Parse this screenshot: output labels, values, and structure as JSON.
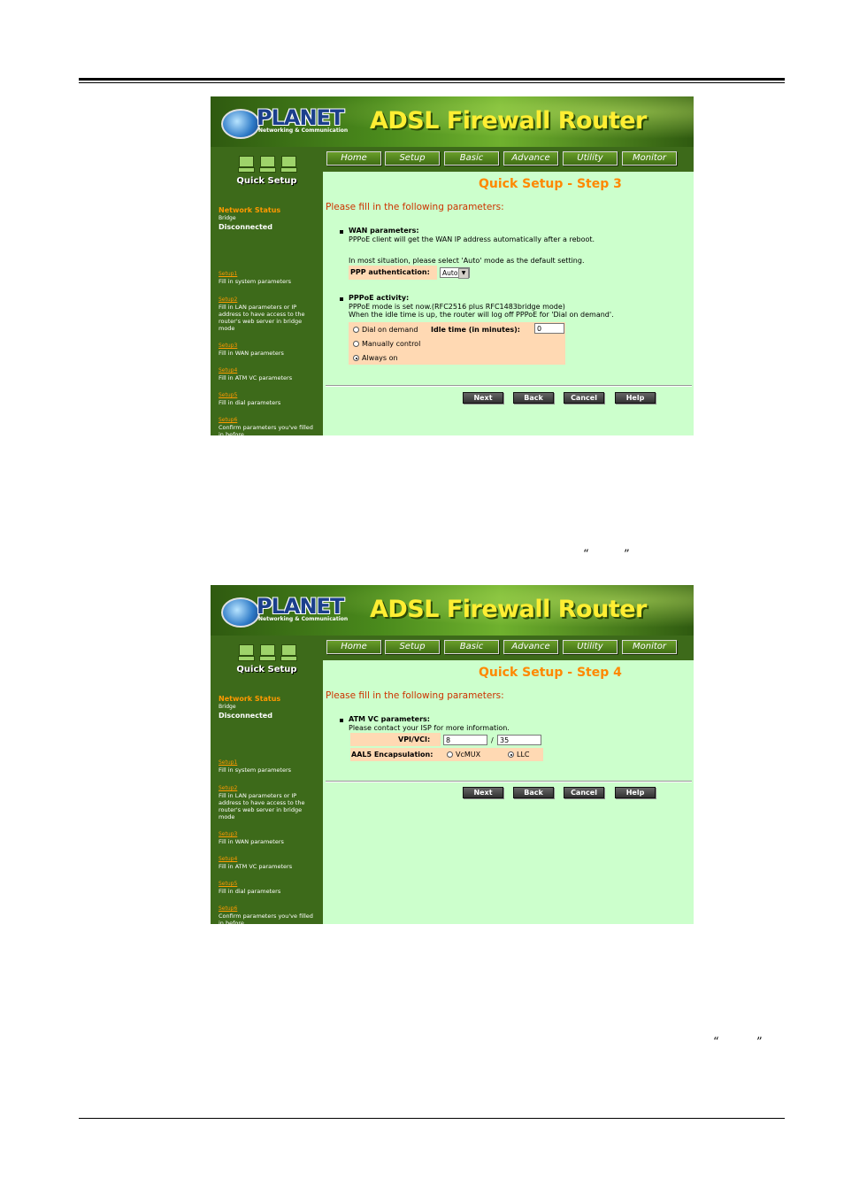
{
  "doc": {
    "quote_marks_1": [
      "“",
      "”"
    ],
    "quote_marks_2": [
      "“",
      "”"
    ]
  },
  "router": {
    "logo_text": "PLANET",
    "logo_tagline": "Networking & Communication",
    "product_name": "ADSL  Firewall Router",
    "nav": [
      "Home",
      "Setup",
      "Basic",
      "Advance",
      "Utility",
      "Monitor"
    ],
    "sidebar": {
      "quick_setup": "Quick Setup",
      "network_status_label": "Network Status",
      "mode": "Bridge",
      "status": "Disconnected",
      "steps": [
        {
          "link": "Setup1",
          "desc": "Fill in system parameters"
        },
        {
          "link": "Setup2",
          "desc": "Fill in LAN parameters or IP address to have access to the router's web server in bridge mode"
        },
        {
          "link": "Setup3",
          "desc": "Fill in WAN parameters"
        },
        {
          "link": "Setup4",
          "desc": "Fill in ATM VC parameters"
        },
        {
          "link": "Setup5",
          "desc": "Fill in dial parameters"
        },
        {
          "link": "Setup6",
          "desc": "Confirm parameters you've filled in before."
        }
      ]
    },
    "buttons": {
      "next": "Next",
      "back": "Back",
      "cancel": "Cancel",
      "help": "Help"
    },
    "intro": "Please fill in the following parameters:"
  },
  "step3": {
    "title": "Quick Setup - Step 3",
    "wan_title": "WAN parameters:",
    "wan_desc": "PPPoE client will get the WAN IP address automatically after a reboot.",
    "wan_hint": "In most situation, please select 'Auto' mode as the default setting.",
    "ppp_auth_label": "PPP authentication:",
    "ppp_auth_value": "Auto",
    "activity_title": "PPPoE activity:",
    "activity_desc1": "PPPoE mode is set now.(RFC2516 plus RFC1483bridge mode)",
    "activity_desc2": "When the idle time is up, the router will log off PPPoE for 'Dial on demand'.",
    "opt_dial": "Dial on demand",
    "idle_label": "Idle time (in minutes):",
    "idle_value": "0",
    "opt_manual": "Manually control",
    "opt_always": "Always on"
  },
  "step4": {
    "title": "Quick Setup - Step 4",
    "atm_title": "ATM VC parameters:",
    "atm_desc": "Please contact your ISP for more information.",
    "vpi_label": "VPI/VCI:",
    "vpi_value": "8",
    "vci_sep": "/",
    "vci_value": "35",
    "aal5_label": "AAL5 Encapsulation:",
    "opt_vcmux": "VcMUX",
    "opt_llc": "LLC"
  }
}
